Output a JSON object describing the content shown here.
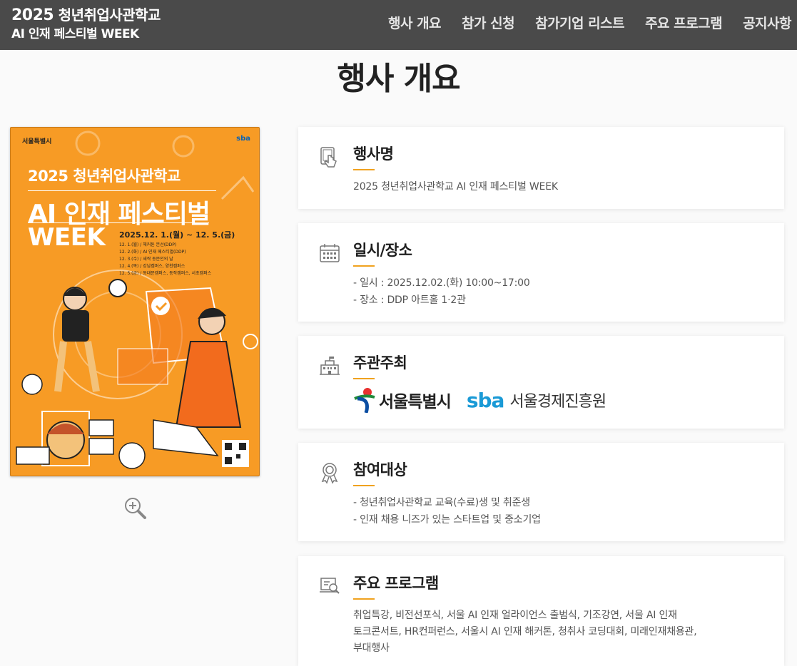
{
  "header": {
    "logo_line1_year": "2025",
    "logo_line1_text": " 청년취업사관학교",
    "logo_line2": "AI 인재 페스티벌 WEEK",
    "nav": [
      "행사 개요",
      "참가 신청",
      "참가기업 리스트",
      "주요 프로그램",
      "공지사항"
    ]
  },
  "page_title": "행사 개요",
  "poster": {
    "top_left": "서울특별시",
    "top_right": "sba",
    "title1": "2025 청년취업사관학교",
    "title2": "AI 인재 페스티벌",
    "title3": "WEEK",
    "date": "2025.12. 1.(월) ~ 12. 5.(금)",
    "schedule": [
      "12. 1.(월) / 해커톤 본선(DDP)",
      "12. 2.(화) / AI 인재 페스티벌(DDP)",
      "12. 3.(수) / 새싹 동문인의 날",
      "12. 4.(목) / 강남캠퍼스, 양천캠퍼스",
      "12. 5.(금) / 동대문캠퍼스, 동작캠퍼스, 서초캠퍼스"
    ]
  },
  "cards": [
    {
      "title": "행사명",
      "icon": "touch-screen-icon",
      "lines": [
        "2025 청년취업사관학교 AI 인재 페스티벌 WEEK"
      ]
    },
    {
      "title": "일시/장소",
      "icon": "calendar-icon",
      "lines": [
        "- 일시 : 2025.12.02.(화) 10:00~17:00",
        "- 장소 : DDP 아트홀 1·2관"
      ]
    },
    {
      "title": "주관주최",
      "icon": "building-icon",
      "org1": "서울특별시",
      "org2_mark": "sba",
      "org2": "서울경제진흥원"
    },
    {
      "title": "참여대상",
      "icon": "award-icon",
      "lines": [
        "- 청년취업사관학교 교육(수료)생 및 취준생",
        "- 인재 채용 니즈가 있는 스타트업 및 중소기업"
      ]
    },
    {
      "title": "주요 프로그램",
      "icon": "program-icon",
      "lines": [
        "취업특강, 비전선포식, 서울 AI 인재 얼라이언스 출범식, 기조강연, 서울 AI 인재",
        "토크콘서트, HR컨퍼런스, 서울시 AI 인재 해커톤, 청취사 코딩대회, 미래인재채용관,",
        "부대행사"
      ]
    }
  ],
  "colors": {
    "header_bg": "#4a4a4a",
    "accent": "#f0a21f",
    "poster_bg": "#f79b25",
    "sba_blue": "#1a9ad6"
  }
}
